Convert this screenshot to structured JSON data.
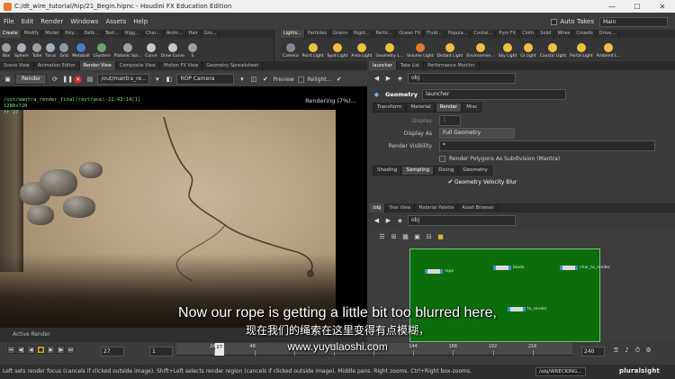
{
  "window": {
    "title": "C:/dt_wire_tutorial/hip/21_Begin.hipnc - Houdini FX Education Edition",
    "controls": [
      "—",
      "☐",
      "✕"
    ]
  },
  "menubar": {
    "items": [
      "File",
      "Edit",
      "Render",
      "Windows",
      "Assets",
      "Help"
    ],
    "auto_takes_label": "Auto Takes",
    "desktop": "Main"
  },
  "shelf_left": {
    "tabs": [
      "Create",
      "Modify",
      "Model",
      "Poly...",
      "Defo...",
      "Text...",
      "Rigg...",
      "Char...",
      "Anim...",
      "Hair",
      "Gro..."
    ],
    "tools": [
      {
        "label": "Box",
        "color": "#9aa0a8"
      },
      {
        "label": "Sphere",
        "color": "#a6b0bc"
      },
      {
        "label": "Tube",
        "color": "#9aa0a8"
      },
      {
        "label": "Torus",
        "color": "#a6b0bc"
      },
      {
        "label": "Grid",
        "color": "#8c98a8"
      },
      {
        "label": "Metaball",
        "color": "#4a7ccf"
      },
      {
        "label": "LSystem",
        "color": "#6fa36f"
      },
      {
        "label": "Platonic Sol...",
        "color": "#9aa0a8"
      },
      {
        "label": "Curve",
        "color": "#c9c9c9"
      },
      {
        "label": "Draw Curve",
        "color": "#c9c9c9"
      },
      {
        "label": "S",
        "color": "#9aa0a8"
      }
    ]
  },
  "shelf_right": {
    "tabs": [
      "Lights...",
      "Particles",
      "Grains",
      "Rigid...",
      "Partic...",
      "Ocean FX",
      "Fluid...",
      "Popula...",
      "Contai...",
      "Pyro FX",
      "Cloth",
      "Solid",
      "Wires",
      "Crowds",
      "Drive..."
    ],
    "tools": [
      {
        "label": "Camera",
        "color": "#7f8a99"
      },
      {
        "label": "Point Light",
        "color": "#f0c040"
      },
      {
        "label": "Spot Light",
        "color": "#f0c040"
      },
      {
        "label": "Area Light",
        "color": "#f0c040"
      },
      {
        "label": "Geometry L...",
        "color": "#f0c040"
      },
      {
        "label": "Volume Light",
        "color": "#e07a30"
      },
      {
        "label": "Distant Light",
        "color": "#f0c040"
      },
      {
        "label": "Environmen...",
        "color": "#f0c040"
      },
      {
        "label": "Sky Light",
        "color": "#f0c040"
      },
      {
        "label": "GI Light",
        "color": "#f0c040"
      },
      {
        "label": "Caustic Light",
        "color": "#f0c040"
      },
      {
        "label": "Portal Light",
        "color": "#f0c040"
      },
      {
        "label": "Ambient L...",
        "color": "#f0c040"
      }
    ]
  },
  "left_pane_tabs": [
    "Scene View",
    "Animation Editor",
    "Render View",
    "Composite View",
    "Motion FX View",
    "Geometry Spreadsheet"
  ],
  "right_top_tabs": [
    "launcher",
    "Take List",
    "Performance Monitor"
  ],
  "render_toolbar": {
    "render_button": "Render",
    "render_path": "/out/mantra_re...",
    "camera": "ROP Camera",
    "preview_label": "Preview",
    "relight_label": "Relight..."
  },
  "render_view": {
    "info_lines": [
      "/out/mantra_render_final(raytrace)-22:43:14[1]",
      "1280x720",
      "fr 27"
    ],
    "status": "Rendering (7%)..."
  },
  "active_render": "Active Render",
  "param_pane": {
    "path": "obj",
    "node_type": "Geometry",
    "node_name": "launcher",
    "tabs": [
      "Transform",
      "Material",
      "Render",
      "Misc"
    ],
    "display_label": "Display",
    "display_value": "1",
    "display_as_label": "Display As",
    "display_as_value": "Full Geometry",
    "render_visibility_label": "Render Visibility",
    "render_visibility_value": "*",
    "render_polygons_label": "Render Polygons As Subdivision (Mantra)",
    "sub_tabs": [
      "Shading",
      "Sampling",
      "Dicing",
      "Geometry"
    ],
    "velocity_blur_label": "Geometry Velocity Blur"
  },
  "network_tabs": [
    "/obj",
    "Tree View",
    "Material Palette",
    "Asset Browser"
  ],
  "network": {
    "path": "obj",
    "nodes": [
      {
        "name": "rope"
      },
      {
        "name": "blade"
      },
      {
        "name": "char_to_render"
      },
      {
        "name": "to_render"
      }
    ]
  },
  "timeline": {
    "current_frame": "27",
    "start_frame": "1",
    "end_frame": "240",
    "ticks": [
      "24",
      "48",
      "72",
      "96",
      "120",
      "144",
      "168",
      "192",
      "216"
    ],
    "playhead_label": "27",
    "range_start": 1,
    "range_end": 240,
    "current": 27
  },
  "statusbar": {
    "text": "Left sets render focus (cancels if clicked outside image). Shift+Left selects render region (cancels if clicked outside image). Middle pans. Right zooms. Ctrl+Right box-zooms.",
    "path": "/obj/WRECKING..."
  },
  "watermark": "pluralsight",
  "subtitles": {
    "en": "Now our rope is getting a little bit too blurred here,",
    "zh": "现在我们的绳索在这里变得有点模糊，",
    "url": "www.yuyulaoshi.com"
  }
}
